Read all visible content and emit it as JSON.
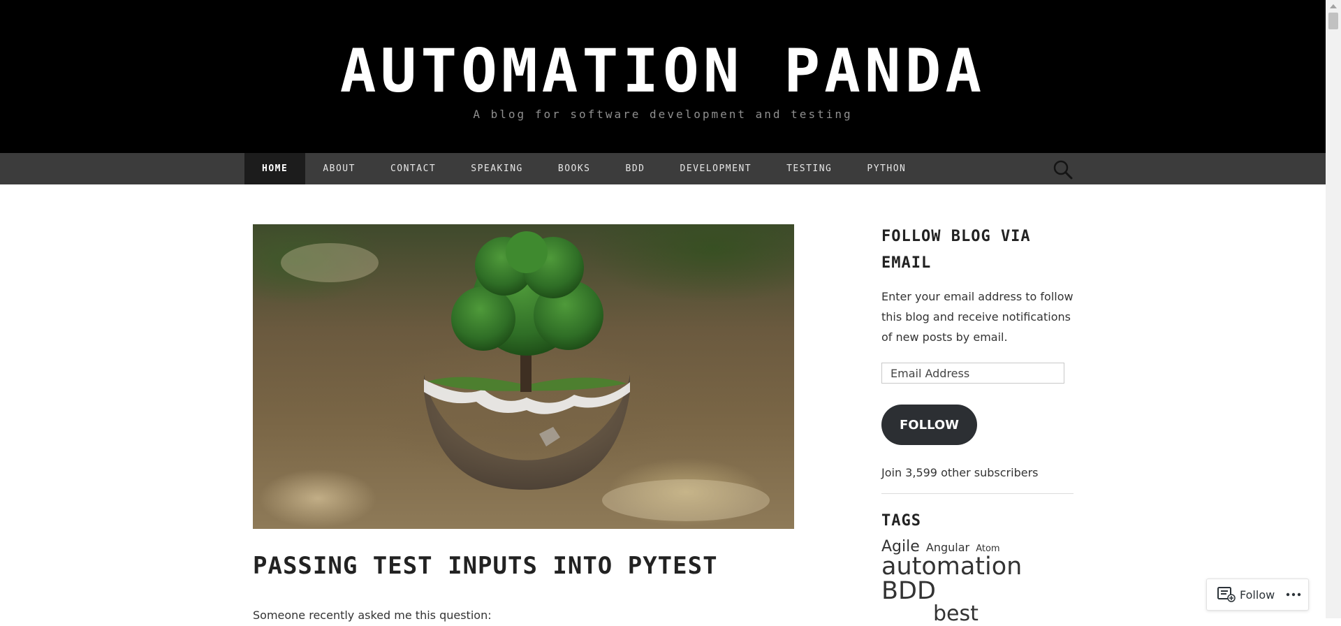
{
  "header": {
    "title": "AUTOMATION PANDA",
    "tagline": "A blog for software development and testing"
  },
  "nav": {
    "items": [
      {
        "label": "HOME",
        "active": true
      },
      {
        "label": "ABOUT"
      },
      {
        "label": "CONTACT"
      },
      {
        "label": "SPEAKING"
      },
      {
        "label": "BOOKS"
      },
      {
        "label": "BDD"
      },
      {
        "label": "DEVELOPMENT"
      },
      {
        "label": "TESTING"
      },
      {
        "label": "PYTHON"
      }
    ],
    "search_icon": "search-icon"
  },
  "post": {
    "image_icon": "tree-in-glass-sphere-image",
    "title": "PASSING TEST INPUTS INTO PYTEST",
    "excerpt": "Someone recently asked me this question:"
  },
  "sidebar": {
    "follow_widget": {
      "title": "FOLLOW BLOG VIA EMAIL",
      "text": "Enter your email address to follow this blog and receive notifications of new posts by email.",
      "email_placeholder": "Email Address",
      "button_label": "FOLLOW",
      "subscribers": "Join 3,599 other subscribers"
    },
    "tags_widget": {
      "title": "TAGS",
      "tags": [
        "Agile",
        "Angular",
        "Atom",
        "automation",
        "BDD",
        "best"
      ]
    }
  },
  "follow_bar": {
    "label": "Follow",
    "icon": "reader-icon",
    "more_icon": "ellipsis-icon"
  },
  "colors": {
    "header_bg": "#000000",
    "nav_bg": "#3c3c3c",
    "nav_active_bg": "#1c1c1c",
    "button_bg": "#2c2f33"
  }
}
